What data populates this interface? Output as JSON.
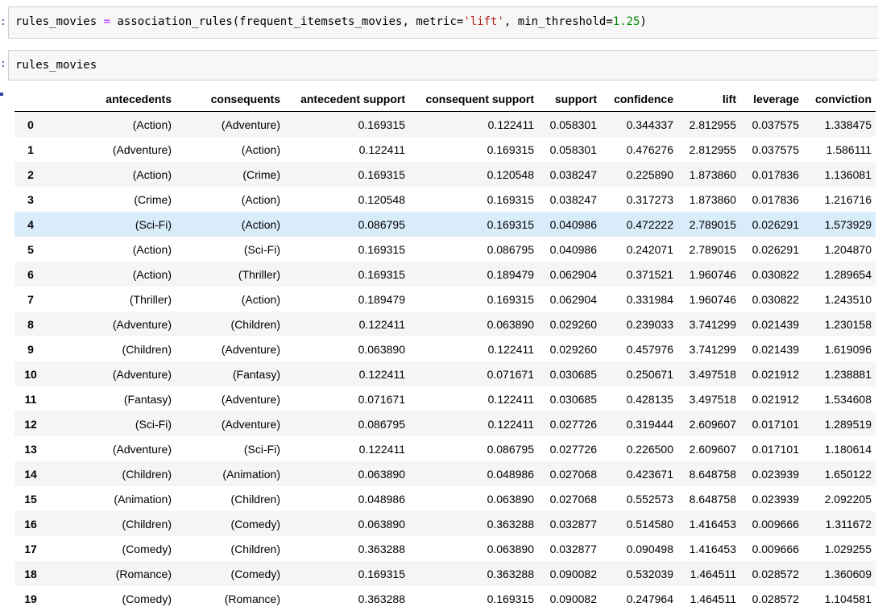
{
  "cells": [
    {
      "prompt": ":",
      "code_var": "rules_movies",
      "code_op": " = ",
      "code_call": "association_rules(frequent_itemsets_movies, metric=",
      "code_str": "'lift'",
      "code_mid": ", min_threshold=",
      "code_num": "1.25",
      "code_end": ")"
    },
    {
      "prompt": ":",
      "code": "rules_movies"
    }
  ],
  "table": {
    "columns": [
      "antecedents",
      "consequents",
      "antecedent support",
      "consequent support",
      "support",
      "confidence",
      "lift",
      "leverage",
      "conviction"
    ],
    "rows": [
      [
        "0",
        "(Action)",
        "(Adventure)",
        "0.169315",
        "0.122411",
        "0.058301",
        "0.344337",
        "2.812955",
        "0.037575",
        "1.338475"
      ],
      [
        "1",
        "(Adventure)",
        "(Action)",
        "0.122411",
        "0.169315",
        "0.058301",
        "0.476276",
        "2.812955",
        "0.037575",
        "1.586111"
      ],
      [
        "2",
        "(Action)",
        "(Crime)",
        "0.169315",
        "0.120548",
        "0.038247",
        "0.225890",
        "1.873860",
        "0.017836",
        "1.136081"
      ],
      [
        "3",
        "(Crime)",
        "(Action)",
        "0.120548",
        "0.169315",
        "0.038247",
        "0.317273",
        "1.873860",
        "0.017836",
        "1.216716"
      ],
      [
        "4",
        "(Sci-Fi)",
        "(Action)",
        "0.086795",
        "0.169315",
        "0.040986",
        "0.472222",
        "2.789015",
        "0.026291",
        "1.573929"
      ],
      [
        "5",
        "(Action)",
        "(Sci-Fi)",
        "0.169315",
        "0.086795",
        "0.040986",
        "0.242071",
        "2.789015",
        "0.026291",
        "1.204870"
      ],
      [
        "6",
        "(Action)",
        "(Thriller)",
        "0.169315",
        "0.189479",
        "0.062904",
        "0.371521",
        "1.960746",
        "0.030822",
        "1.289654"
      ],
      [
        "7",
        "(Thriller)",
        "(Action)",
        "0.189479",
        "0.169315",
        "0.062904",
        "0.331984",
        "1.960746",
        "0.030822",
        "1.243510"
      ],
      [
        "8",
        "(Adventure)",
        "(Children)",
        "0.122411",
        "0.063890",
        "0.029260",
        "0.239033",
        "3.741299",
        "0.021439",
        "1.230158"
      ],
      [
        "9",
        "(Children)",
        "(Adventure)",
        "0.063890",
        "0.122411",
        "0.029260",
        "0.457976",
        "3.741299",
        "0.021439",
        "1.619096"
      ],
      [
        "10",
        "(Adventure)",
        "(Fantasy)",
        "0.122411",
        "0.071671",
        "0.030685",
        "0.250671",
        "3.497518",
        "0.021912",
        "1.238881"
      ],
      [
        "11",
        "(Fantasy)",
        "(Adventure)",
        "0.071671",
        "0.122411",
        "0.030685",
        "0.428135",
        "3.497518",
        "0.021912",
        "1.534608"
      ],
      [
        "12",
        "(Sci-Fi)",
        "(Adventure)",
        "0.086795",
        "0.122411",
        "0.027726",
        "0.319444",
        "2.609607",
        "0.017101",
        "1.289519"
      ],
      [
        "13",
        "(Adventure)",
        "(Sci-Fi)",
        "0.122411",
        "0.086795",
        "0.027726",
        "0.226500",
        "2.609607",
        "0.017101",
        "1.180614"
      ],
      [
        "14",
        "(Children)",
        "(Animation)",
        "0.063890",
        "0.048986",
        "0.027068",
        "0.423671",
        "8.648758",
        "0.023939",
        "1.650122"
      ],
      [
        "15",
        "(Animation)",
        "(Children)",
        "0.048986",
        "0.063890",
        "0.027068",
        "0.552573",
        "8.648758",
        "0.023939",
        "2.092205"
      ],
      [
        "16",
        "(Children)",
        "(Comedy)",
        "0.063890",
        "0.363288",
        "0.032877",
        "0.514580",
        "1.416453",
        "0.009666",
        "1.311672"
      ],
      [
        "17",
        "(Comedy)",
        "(Children)",
        "0.363288",
        "0.063890",
        "0.032877",
        "0.090498",
        "1.416453",
        "0.009666",
        "1.029255"
      ],
      [
        "18",
        "(Romance)",
        "(Comedy)",
        "0.169315",
        "0.363288",
        "0.090082",
        "0.532039",
        "1.464511",
        "0.028572",
        "1.360609"
      ],
      [
        "19",
        "(Comedy)",
        "(Romance)",
        "0.363288",
        "0.169315",
        "0.090082",
        "0.247964",
        "1.464511",
        "0.028572",
        "1.104581"
      ]
    ],
    "highlighted_row": 4
  }
}
